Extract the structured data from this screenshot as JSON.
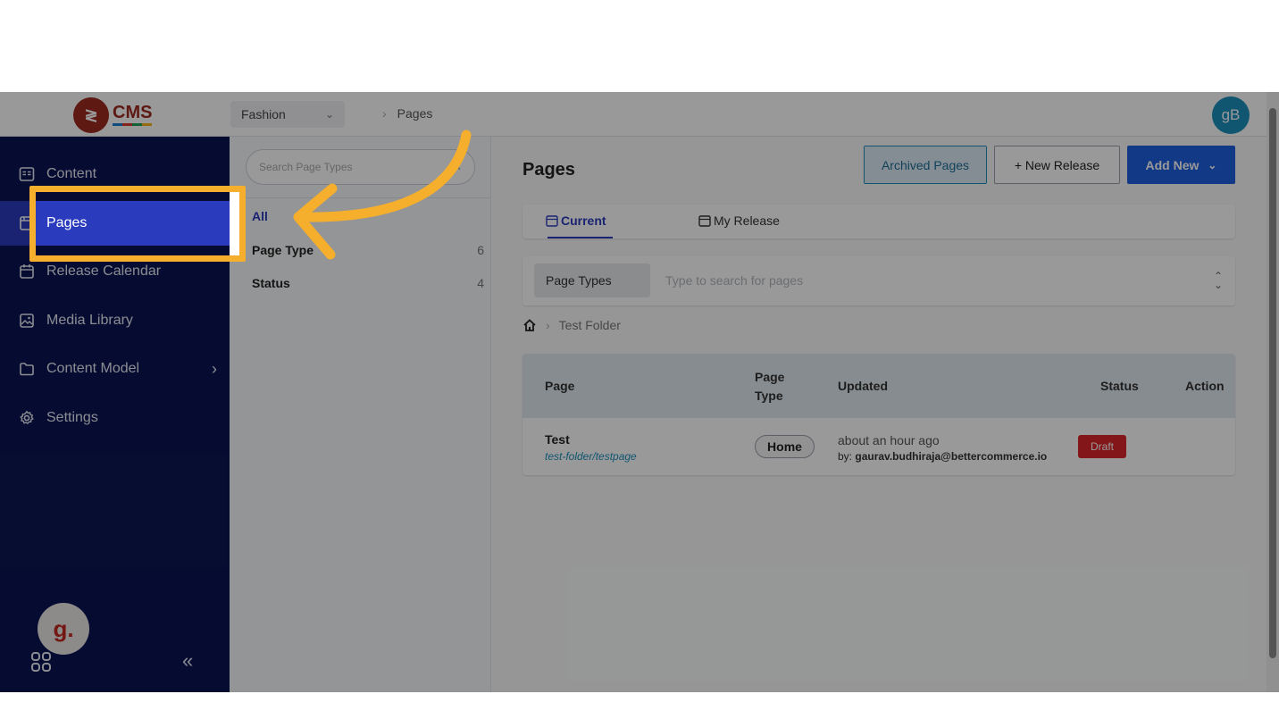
{
  "topbar": {
    "logo_text": "CMS",
    "store": "Fashion",
    "breadcrumb": "Pages",
    "avatar_initials": "gB"
  },
  "sidebar": {
    "items": [
      {
        "label": "Content",
        "icon": "content-icon"
      },
      {
        "label": "Pages",
        "icon": "pages-icon",
        "active": true
      },
      {
        "label": "Release Calendar",
        "icon": "calendar-icon"
      },
      {
        "label": "Media Library",
        "icon": "image-icon"
      },
      {
        "label": "Content Model",
        "icon": "folder-icon",
        "has_children": true
      },
      {
        "label": "Settings",
        "icon": "gear-icon"
      }
    ],
    "assistant_letter": "g.",
    "collapse_glyph": "«"
  },
  "filter": {
    "search_placeholder": "Search Page Types",
    "rows": [
      {
        "label": "All",
        "count": ""
      },
      {
        "label": "Page Type",
        "count": "6"
      },
      {
        "label": "Status",
        "count": "4"
      }
    ]
  },
  "main": {
    "title": "Pages",
    "buttons": {
      "archived": "Archived Pages",
      "new_release": "+ New Release",
      "add_new": "Add New"
    },
    "tabs": [
      {
        "label": "Current",
        "active": true
      },
      {
        "label": "My Release",
        "active": false
      }
    ],
    "page_type_select": "Page Types",
    "search_placeholder": "Type to search for pages",
    "breadcrumb_folder": "Test Folder",
    "table": {
      "headers": {
        "page": "Page",
        "page_type_1": "Page",
        "page_type_2": "Type",
        "updated": "Updated",
        "status": "Status",
        "action": "Action"
      },
      "rows": [
        {
          "name": "Test",
          "slug": "test-folder/testpage",
          "page_type": "Home",
          "updated": "about an hour ago",
          "by_prefix": "by:",
          "by_user": "gaurav.budhiraja@bettercommerce.io",
          "status": "Draft"
        }
      ]
    }
  },
  "colors": {
    "sidebar": "#0b1452",
    "accent": "#2a3bbd",
    "highlight": "#f6ae2d",
    "draft": "#d9262b",
    "primary_button": "#1f5fe0"
  }
}
